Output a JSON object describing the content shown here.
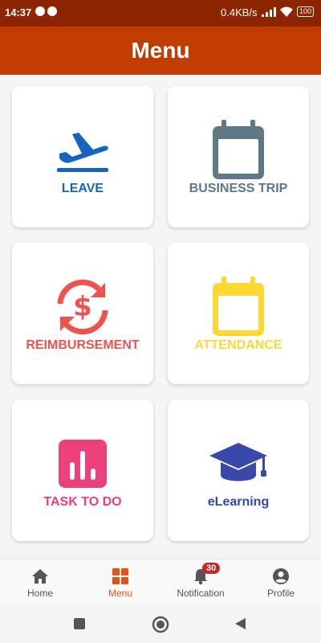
{
  "status_bar": {
    "time": "14:37",
    "network_speed": "0.4KB/s",
    "battery": "100"
  },
  "header": {
    "title": "Menu"
  },
  "menu_items": [
    {
      "label": "LEAVE",
      "color": "#1565c0",
      "icon": "airplane-takeoff-icon"
    },
    {
      "label": "BUSINESS TRIP",
      "color": "#5f7886",
      "icon": "calendar-icon"
    },
    {
      "label": "REIMBURSEMENT",
      "color": "#ef5350",
      "icon": "dollar-refresh-icon"
    },
    {
      "label": "ATTENDANCE",
      "color": "#fdd835",
      "icon": "calendar-icon"
    },
    {
      "label": "TASK TO DO",
      "color": "#ec407a",
      "icon": "bar-chart-icon"
    },
    {
      "label": "eLearning",
      "color": "#3949ab",
      "icon": "graduation-cap-icon"
    }
  ],
  "bottom_nav": {
    "items": [
      {
        "label": "Home",
        "icon": "home-icon"
      },
      {
        "label": "Menu",
        "icon": "grid-icon",
        "active": true
      },
      {
        "label": "Notification",
        "icon": "bell-icon",
        "badge": "30"
      },
      {
        "label": "Profile",
        "icon": "person-icon"
      }
    ],
    "active_color": "#e0561a"
  },
  "colors": {
    "status_bar": "#8c2500",
    "header": "#c13c00",
    "background": "#f5f5f5"
  }
}
